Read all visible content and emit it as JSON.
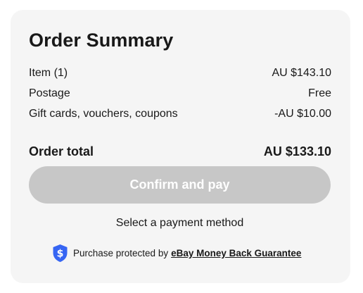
{
  "summary": {
    "title": "Order Summary",
    "lines": [
      {
        "label": "Item (1)",
        "value": "AU $143.10"
      },
      {
        "label": "Postage",
        "value": "Free"
      },
      {
        "label": "Gift cards, vouchers, coupons",
        "value": "-AU $10.00"
      }
    ],
    "total": {
      "label": "Order total",
      "value": "AU $133.10"
    }
  },
  "actions": {
    "confirm_label": "Confirm and pay",
    "payment_hint": "Select a payment method"
  },
  "guarantee": {
    "icon": "shield-dollar-icon",
    "text": "Purchase protected by",
    "link": "eBay Money Back Guarantee",
    "accent_color": "#3665f3"
  },
  "colors": {
    "card_background": "#f5f5f5",
    "button_disabled": "#c7c7c7",
    "text": "#191919"
  }
}
